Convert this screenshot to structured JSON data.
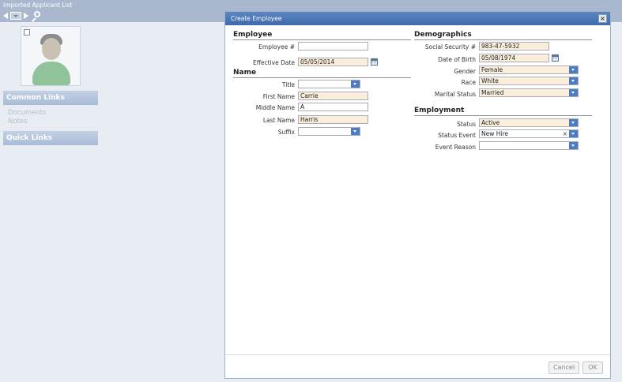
{
  "app": {
    "title": "Imported Applicant List"
  },
  "sidebar": {
    "common_links_title": "Common Links",
    "common_links": [
      "Documents",
      "Notes"
    ],
    "quick_links_title": "Quick Links"
  },
  "dialog": {
    "title": "Create Employee",
    "close_label": "×",
    "employee": {
      "heading": "Employee",
      "employee_num_label": "Employee #",
      "employee_num_value": "",
      "effective_date_label": "Effective Date",
      "effective_date_value": "05/05/2014"
    },
    "name": {
      "heading": "Name",
      "title_label": "Title",
      "title_value": "",
      "first_label": "First Name",
      "first_value": "Carrie",
      "middle_label": "Middle Name",
      "middle_value": "A",
      "last_label": "Last Name",
      "last_value": "Harris",
      "suffix_label": "Suffix",
      "suffix_value": ""
    },
    "demographics": {
      "heading": "Demographics",
      "ssn_label": "Social Security #",
      "ssn_value": "983-47-5932",
      "dob_label": "Date of Birth",
      "dob_value": "05/08/1974",
      "gender_label": "Gender",
      "gender_value": "Female",
      "race_label": "Race",
      "race_value": "White",
      "marital_label": "Marital Status",
      "marital_value": "Married"
    },
    "employment": {
      "heading": "Employment",
      "status_label": "Status",
      "status_value": "Active",
      "event_label": "Status Event",
      "event_value": "New Hire",
      "event_clear": "×",
      "reason_label": "Event Reason",
      "reason_value": ""
    },
    "buttons": {
      "cancel": "Cancel",
      "ok": "OK"
    }
  },
  "colors": {
    "header_blue": "#4a77b8",
    "filled_field": "#fbefdc",
    "dropdown_blue": "#4d7cc4"
  }
}
